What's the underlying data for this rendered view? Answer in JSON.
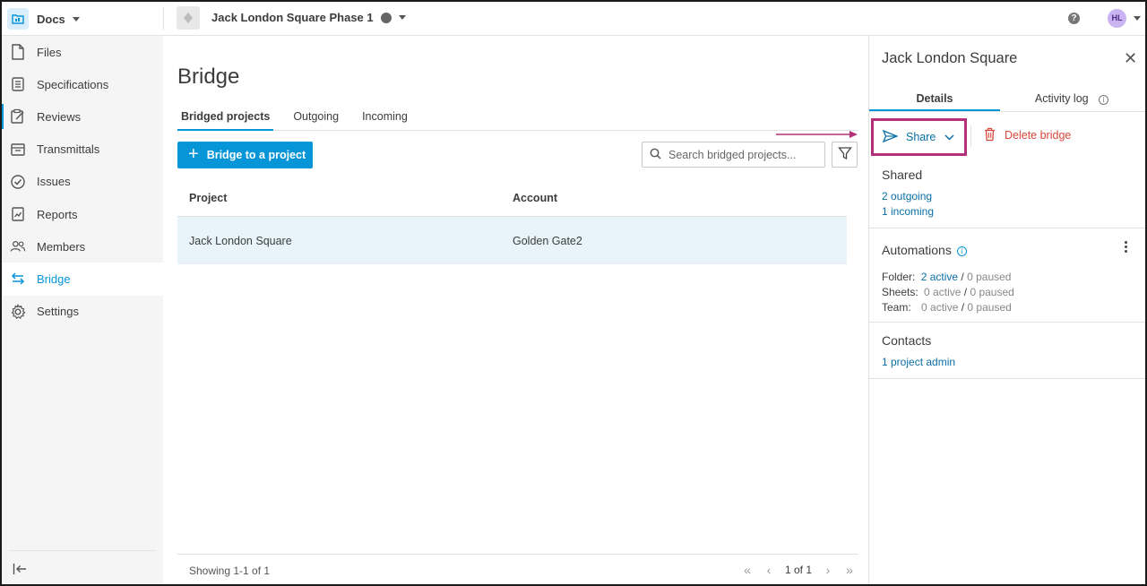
{
  "topbar": {
    "app_name": "Docs",
    "project_name": "Jack London Square Phase 1",
    "help_label": "?",
    "avatar_initials": "HL"
  },
  "sidebar": {
    "items": [
      {
        "label": "Files",
        "icon": "file-icon"
      },
      {
        "label": "Specifications",
        "icon": "specifications-icon"
      },
      {
        "label": "Reviews",
        "icon": "reviews-icon"
      },
      {
        "label": "Transmittals",
        "icon": "transmittals-icon"
      },
      {
        "label": "Issues",
        "icon": "issues-icon"
      },
      {
        "label": "Reports",
        "icon": "reports-icon"
      },
      {
        "label": "Members",
        "icon": "members-icon"
      },
      {
        "label": "Bridge",
        "icon": "bridge-icon",
        "active": true
      },
      {
        "label": "Settings",
        "icon": "settings-icon"
      }
    ]
  },
  "main": {
    "title": "Bridge",
    "tabs": [
      "Bridged projects",
      "Outgoing",
      "Incoming"
    ],
    "active_tab": "Bridged projects",
    "add_button": "Bridge to a project",
    "search_placeholder": "Search bridged projects...",
    "table": {
      "headers": [
        "Project",
        "Account"
      ],
      "rows": [
        {
          "project": "Jack London Square",
          "account": "Golden Gate2"
        }
      ]
    },
    "footer": {
      "showing": "Showing 1-1 of 1",
      "page": "1 of 1"
    }
  },
  "panel": {
    "title": "Jack London Square",
    "tabs": [
      "Details",
      "Activity log"
    ],
    "share_label": "Share",
    "delete_label": "Delete bridge",
    "shared": {
      "title": "Shared",
      "outgoing": "2 outgoing",
      "incoming": "1 incoming"
    },
    "automations": {
      "title": "Automations",
      "folder_label": "Folder:",
      "folder_active": "2 active",
      "folder_paused": "0 paused",
      "sheets_label": "Sheets:",
      "sheets_active": "0 active",
      "sheets_paused": "0 paused",
      "team_label": "Team:",
      "team_active": "0 active",
      "team_paused": "0 paused",
      "separator": "/"
    },
    "contacts": {
      "title": "Contacts",
      "admin": "1 project admin"
    }
  },
  "colors": {
    "accent": "#0696d7",
    "link": "#0a6fa4",
    "danger": "#d9473b",
    "highlight": "#b5307a",
    "row_selected": "#e8f4fa"
  }
}
